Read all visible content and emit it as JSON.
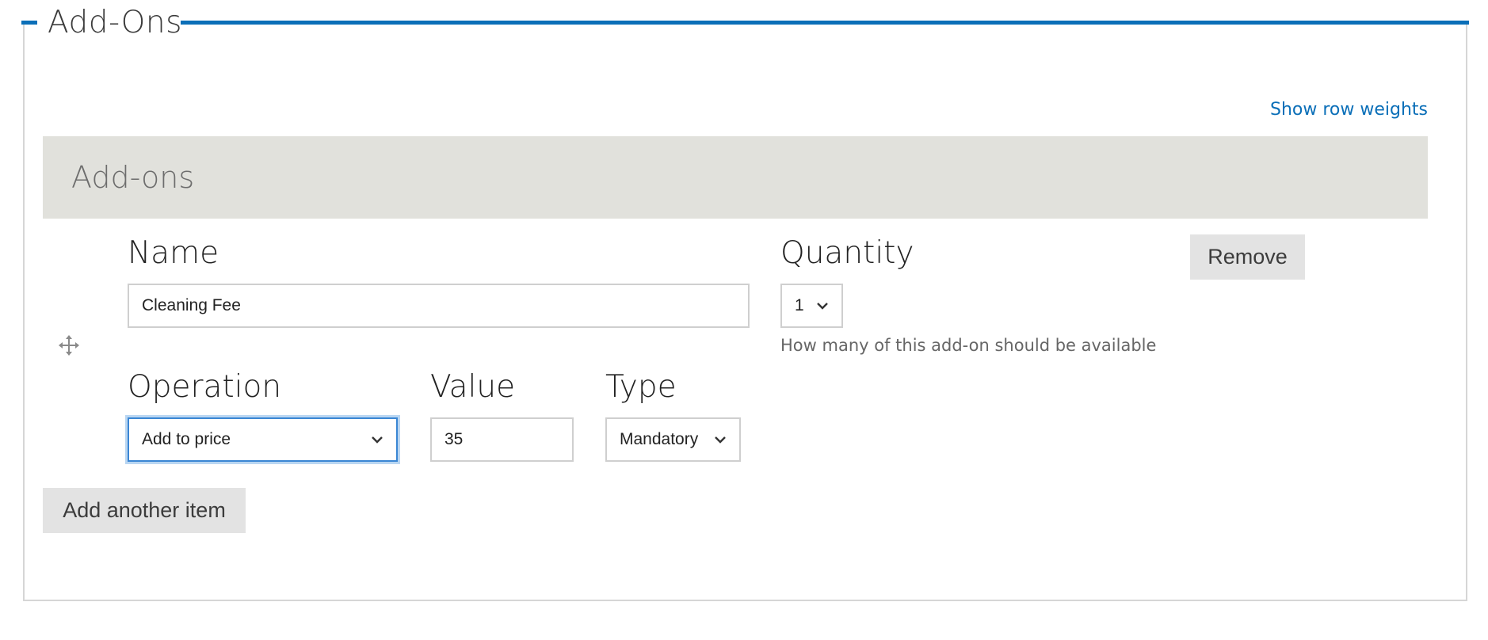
{
  "fieldset": {
    "legend": "Add-Ons",
    "accent_color": "#0b6fb8"
  },
  "table": {
    "show_row_weights_label": "Show row weights",
    "header_title": "Add-ons"
  },
  "row": {
    "drag_icon": "move-arrows-icon",
    "name": {
      "label": "Name",
      "value": "Cleaning Fee"
    },
    "quantity": {
      "label": "Quantity",
      "selected": "1",
      "description": "How many of this add-on should be available"
    },
    "operation": {
      "label": "Operation",
      "selected": "Add to price"
    },
    "value": {
      "label": "Value",
      "value": "35"
    },
    "type": {
      "label": "Type",
      "selected": "Mandatory"
    },
    "remove_label": "Remove"
  },
  "add_another_label": "Add another item",
  "colors": {
    "link": "#0b6fb8",
    "header_bg": "#e1e1dc",
    "button_bg": "#e3e3e3",
    "focus_border": "#3a86d4"
  }
}
